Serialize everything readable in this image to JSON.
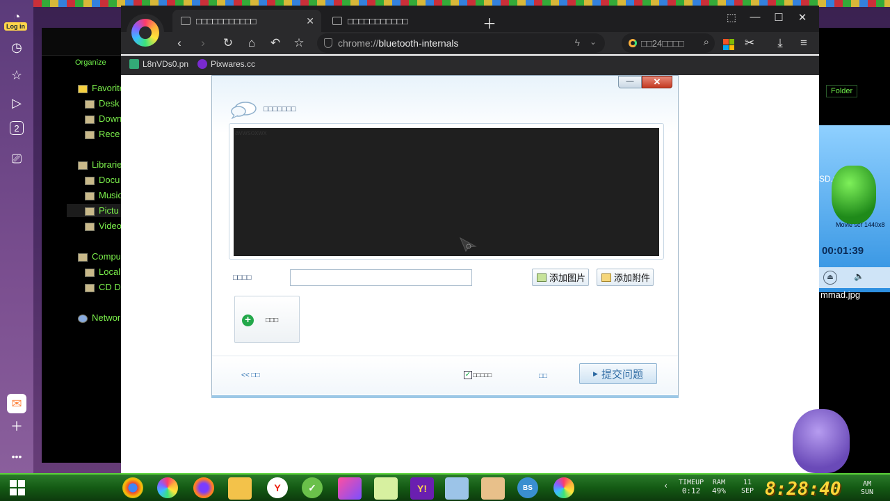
{
  "desktop": {
    "login_badge": "Log in",
    "dock_counter": "2"
  },
  "explorer": {
    "organize": "Organize",
    "tree": [
      "Favorite",
      "Desk",
      "Down",
      "Rece",
      "Librarie",
      "Docu",
      "Music",
      "Pictu",
      "Video",
      "Compu",
      "Local",
      "CD D",
      "Networ"
    ]
  },
  "right_window": {
    "folder_btn": "Folder",
    "sd_label": "SD.pnc",
    "movie_label": "Movie scr 1440x8",
    "timer": "00:01:39",
    "image_label": "mmad.jpg"
  },
  "browser": {
    "tabs": [
      {
        "title": "□□□□□□□□□□□"
      },
      {
        "title": "□□□□□□□□□□□"
      }
    ],
    "url_scheme": "chrome://",
    "url_host": "bluetooth-internals",
    "search_text": "□□24□□□□",
    "bookmarks": [
      {
        "label": "L8nVDs0.pn"
      },
      {
        "label": "Pixwares.cc"
      }
    ]
  },
  "dialog": {
    "title": "□□□□□□□",
    "video_overlay_text": "avwsoxwx",
    "field_label": "□□□□",
    "field_value": "",
    "add_image_btn": "添加图片",
    "add_attach_btn": "添加附件",
    "add_box_label": "□□□",
    "back_link": "<< □□",
    "checkbox_label": "□□□□□",
    "checkbox_checked": true,
    "mid_link": "□□",
    "submit_btn": "提交问题"
  },
  "taskbar": {
    "timeup_label": "TIMEUP",
    "timeup_value": "0:12",
    "ram_label": "RAM",
    "ram_value": "49%",
    "date_day": "11",
    "date_month": "SEP",
    "clock": "8:28:40",
    "ampm": "AM",
    "weekday": "SUN"
  },
  "colors": {
    "accent": "#2d6aa3",
    "taskbar_green": "#145a14",
    "clock_yellow": "#ffd63a",
    "browser_dark": "#1e1e20"
  }
}
